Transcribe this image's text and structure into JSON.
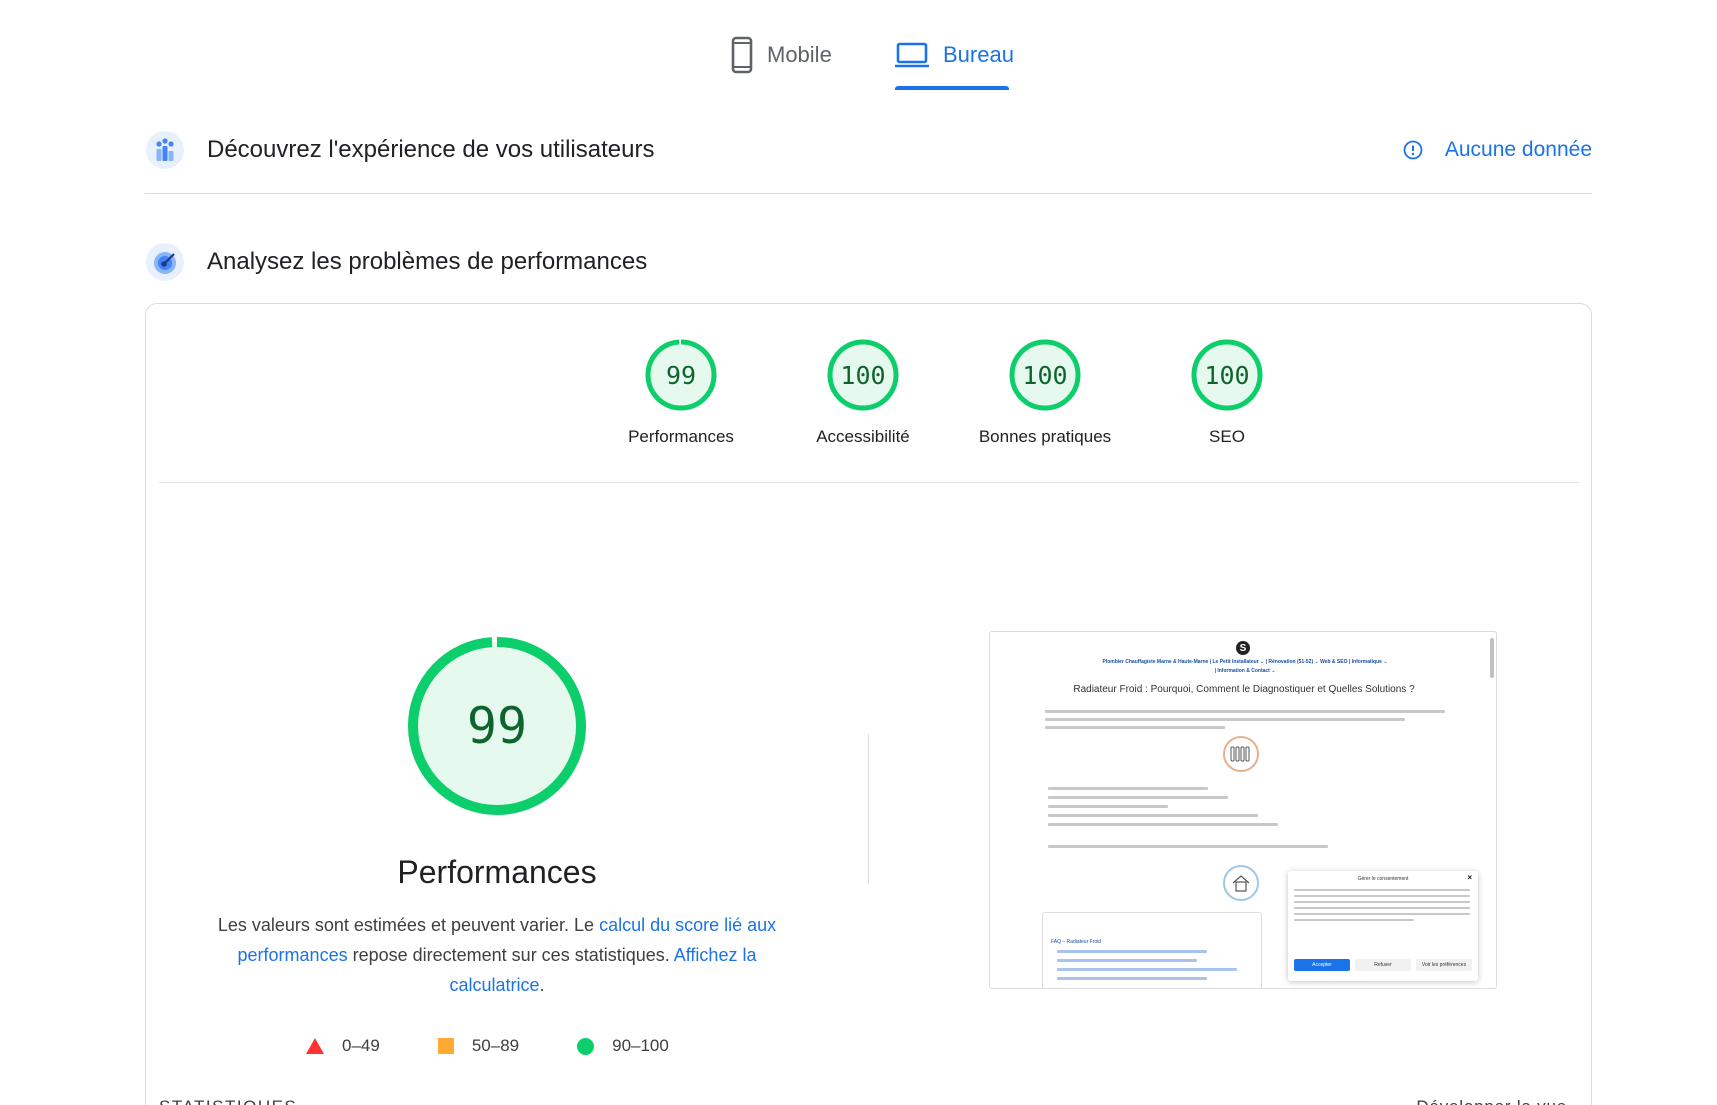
{
  "tabs": [
    {
      "label": "Mobile",
      "icon": "smartphone-icon",
      "active": false
    },
    {
      "label": "Bureau",
      "icon": "laptop-icon",
      "active": true
    }
  ],
  "sections": {
    "field_data": {
      "title": "Découvrez l'expérience de vos utilisateurs",
      "status": "Aucune donnée"
    },
    "lab_data": {
      "title": "Analysez les problèmes de performances"
    }
  },
  "scores": [
    {
      "label": "Performances",
      "value": "99",
      "fraction": 0.99
    },
    {
      "label": "Accessibilité",
      "value": "100",
      "fraction": 1.0
    },
    {
      "label": "Bonnes pratiques",
      "value": "100",
      "fraction": 1.0
    },
    {
      "label": "SEO",
      "value": "100",
      "fraction": 1.0
    }
  ],
  "main_score": {
    "value": "99",
    "fraction": 0.99,
    "title": "Performances",
    "desc_1": "Les valeurs sont estimées et peuvent varier. Le ",
    "link_1": "calcul du score lié aux performances",
    "desc_2": " repose directement sur ces statistiques. ",
    "link_2": "Affichez la calculatrice",
    "desc_3": "."
  },
  "legend": [
    {
      "range": "0–49",
      "shape": "triangle",
      "color": "#ff3333"
    },
    {
      "range": "50–89",
      "shape": "square",
      "color": "#ffaa33"
    },
    {
      "range": "90–100",
      "shape": "circle",
      "color": "#0cce6b"
    }
  ],
  "colors": {
    "good": "#0cce6b",
    "good_bg": "#e6f9ef",
    "good_text": "#0d652d",
    "accent": "#1a73e8"
  },
  "thumbnail": {
    "logo": "S",
    "nav": "Plombier Chauffagiste Marne & Haute-Marne | Le Petit Installateur ⌄   | Rénovation (51-52) ⌄   Web & SEO   | Informatique ⌄",
    "nav_2": "| Information & Contact ⌄",
    "heading": "Radiateur Froid : Pourquoi, Comment le Diagnostiquer et Quelles Solutions ?",
    "modal_title": "Gérer le consentement",
    "modal_accept": "Accepter",
    "modal_refuse": "Refuser",
    "modal_prefs": "Voir les préférences",
    "faq_title": "FAQ – Radiateur Froid"
  },
  "statistics": {
    "label": "STATISTIQUES",
    "expand": "Développer la vue"
  }
}
